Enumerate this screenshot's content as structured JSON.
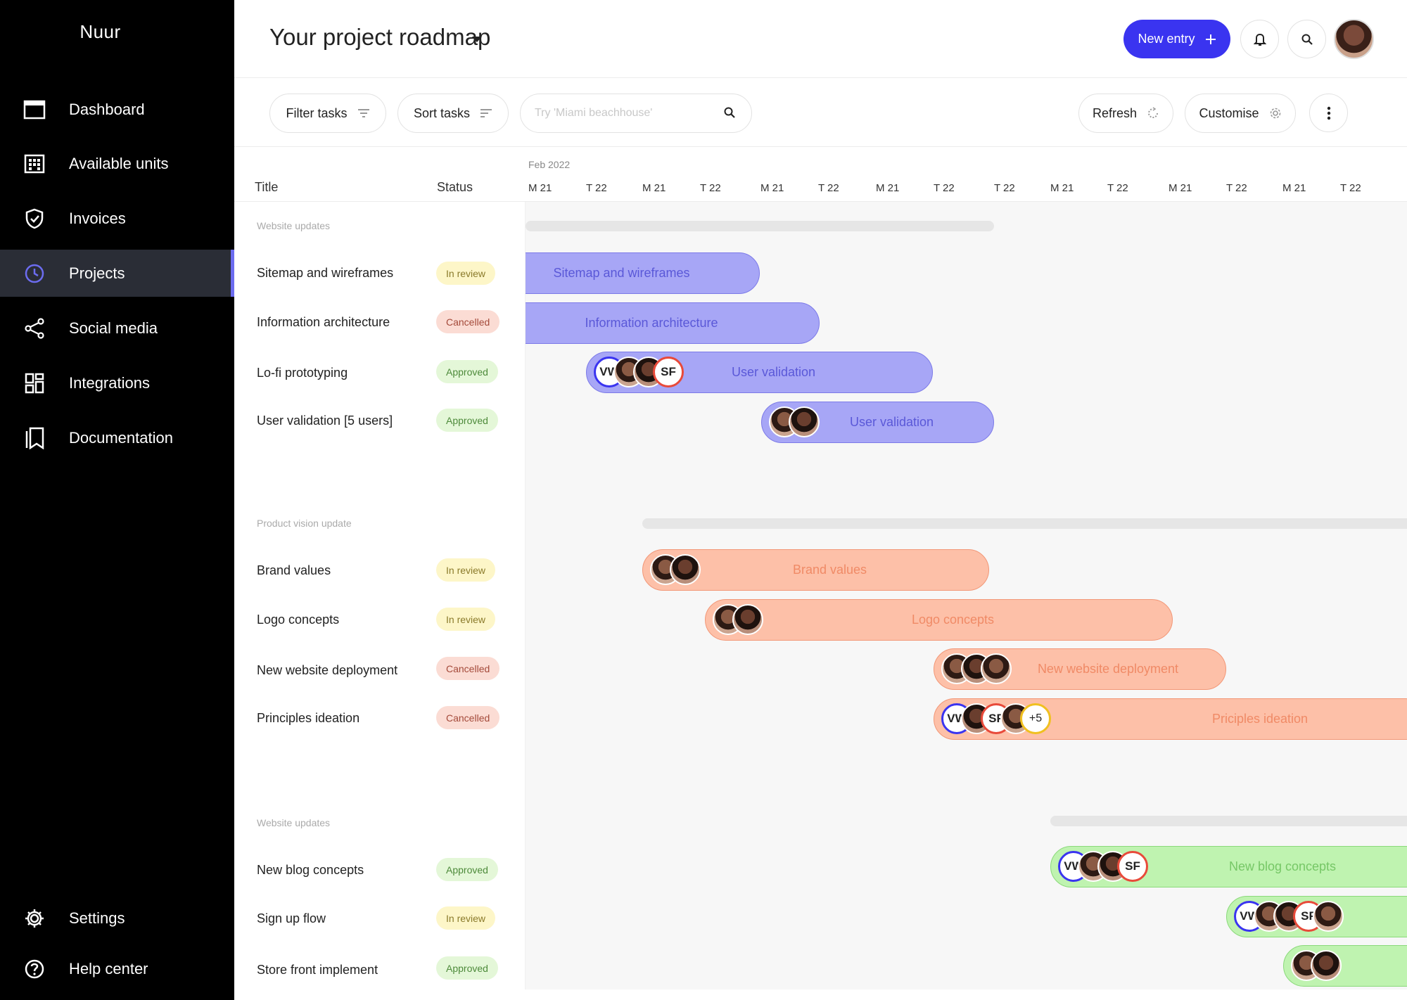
{
  "app": {
    "brand": "Nuur"
  },
  "sidebar": {
    "items": [
      {
        "label": "Dashboard",
        "icon": "dashboard-icon"
      },
      {
        "label": "Available units",
        "icon": "building-icon"
      },
      {
        "label": "Invoices",
        "icon": "shield-check-icon"
      },
      {
        "label": "Projects",
        "icon": "clock-icon",
        "active": true
      },
      {
        "label": "Social media",
        "icon": "share-icon"
      },
      {
        "label": "Integrations",
        "icon": "grid-icon"
      },
      {
        "label": "Documentation",
        "icon": "bookmark-icon"
      }
    ],
    "bottom": [
      {
        "label": "Settings",
        "icon": "gear-icon"
      },
      {
        "label": "Help center",
        "icon": "help-icon"
      }
    ]
  },
  "header": {
    "title": "Your project roadmap",
    "new_entry_label": "New entry"
  },
  "toolbar": {
    "filter_label": "Filter tasks",
    "sort_label": "Sort tasks",
    "search_placeholder": "Try 'Miami beachhouse'",
    "refresh_label": "Refresh",
    "customise_label": "Customise"
  },
  "table": {
    "col_title": "Title",
    "col_status": "Status",
    "month": "Feb 2022",
    "days": [
      "M 21",
      "T 22",
      "M 21",
      "T 22",
      "M 21",
      "T 22",
      "M 21",
      "T 22",
      "T 22",
      "M 21",
      "T 22",
      "M 21",
      "T 22",
      "M 21",
      "T 22"
    ]
  },
  "groups": [
    {
      "label": "Website updates",
      "tasks": [
        {
          "title": "Sitemap and wireframes",
          "status": "In review",
          "bar_label": "Sitemap and wireframes"
        },
        {
          "title": "Information architecture",
          "status": "Cancelled",
          "bar_label": "Information architecture"
        },
        {
          "title": "Lo-fi prototyping",
          "status": "Approved",
          "bar_label": "User validation",
          "initials": [
            "VW",
            "SF"
          ]
        },
        {
          "title": "User validation [5 users]",
          "status": "Approved",
          "bar_label": "User validation"
        }
      ]
    },
    {
      "label": "Product vision update",
      "tasks": [
        {
          "title": "Brand values",
          "status": "In review",
          "bar_label": "Brand values"
        },
        {
          "title": "Logo concepts",
          "status": "In review",
          "bar_label": "Logo concepts"
        },
        {
          "title": "New website deployment",
          "status": "Cancelled",
          "bar_label": "New website deployment"
        },
        {
          "title": "Principles ideation",
          "status": "Cancelled",
          "bar_label": "Priciples ideation",
          "initials": [
            "VW",
            "SF"
          ],
          "more": "+5"
        }
      ]
    },
    {
      "label": "Website updates",
      "tasks": [
        {
          "title": "New blog concepts",
          "status": "Approved",
          "bar_label": "New blog concepts",
          "initials": [
            "VW",
            "SF"
          ]
        },
        {
          "title": "Sign up flow",
          "status": "In review",
          "initials": [
            "VW",
            "SF"
          ]
        },
        {
          "title": "Store front implement",
          "status": "Approved"
        }
      ]
    }
  ],
  "colors": {
    "accent": "#3a34f0",
    "purple_bar": "#a7a6f6",
    "orange_bar": "#fdc0a8",
    "green_bar": "#bff3b0"
  }
}
